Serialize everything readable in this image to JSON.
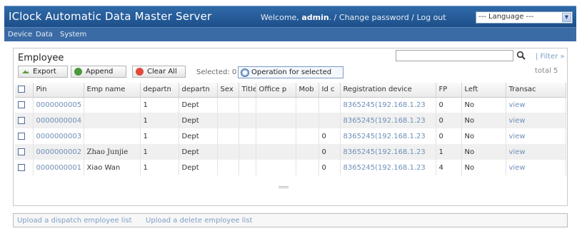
{
  "app": {
    "title": "IClock Automatic Data Master Server",
    "welcome_prefix": "Welcome, ",
    "user": "admin",
    "sep1": ". / ",
    "change_password": "Change password",
    "sep2": " / ",
    "logout": "Log out",
    "language": "--- Language ---"
  },
  "menu": [
    "Device",
    "Data",
    "System"
  ],
  "panel": {
    "title": "Employee",
    "search_value": "",
    "filter": "| Filter »",
    "total": "total 5",
    "selected": "Selected: 0",
    "operation": "Operation for selected"
  },
  "toolbar": {
    "export": "Export",
    "append": "Append",
    "clear_all": "Clear All"
  },
  "table": {
    "headers": [
      "",
      "Pin",
      "Emp name",
      "departn",
      "departn",
      "Sex",
      "Title",
      "Office p",
      "Mob",
      "Id c",
      "Registration device",
      "FP",
      "Left",
      "Transac"
    ],
    "rows": [
      {
        "pin": "0000000005",
        "name": "",
        "dept_no": "1",
        "dept": "Dept",
        "sex": "",
        "title": "",
        "office": "",
        "mob": "",
        "idc": "",
        "device": "8365245(192.168.1.23",
        "fp": "0",
        "left": "No",
        "trans": "view"
      },
      {
        "pin": "0000000004",
        "name": "",
        "dept_no": "1",
        "dept": "Dept",
        "sex": "",
        "title": "",
        "office": "",
        "mob": "",
        "idc": "",
        "device": "8365245(192.168.1.23",
        "fp": "0",
        "left": "No",
        "trans": "view"
      },
      {
        "pin": "0000000003",
        "name": "",
        "dept_no": "1",
        "dept": "Dept",
        "sex": "",
        "title": "",
        "office": "",
        "mob": "",
        "idc": "0",
        "device": "8365245(192.168.1.23",
        "fp": "0",
        "left": "No",
        "trans": "view"
      },
      {
        "pin": "0000000002",
        "name": "Zhao Junjie",
        "dept_no": "1",
        "dept": "Dept",
        "sex": "",
        "title": "",
        "office": "",
        "mob": "",
        "idc": "0",
        "device": "8365245(192.168.1.23",
        "fp": "1",
        "left": "No",
        "trans": "view"
      },
      {
        "pin": "0000000001",
        "name": "Xiao Wan",
        "dept_no": "1",
        "dept": "Dept",
        "sex": "",
        "title": "",
        "office": "",
        "mob": "",
        "idc": "0",
        "device": "8365245(192.168.1.23",
        "fp": "4",
        "left": "No",
        "trans": "view"
      }
    ]
  },
  "footer": {
    "upload_dispatch": "Upload a dispatch employee list",
    "upload_delete": "Upload a delete employee list"
  },
  "colors": {
    "header_bg": "#2f6aa8",
    "menubar_bg": "#3b6ba5",
    "link": "#6f8fb8"
  }
}
